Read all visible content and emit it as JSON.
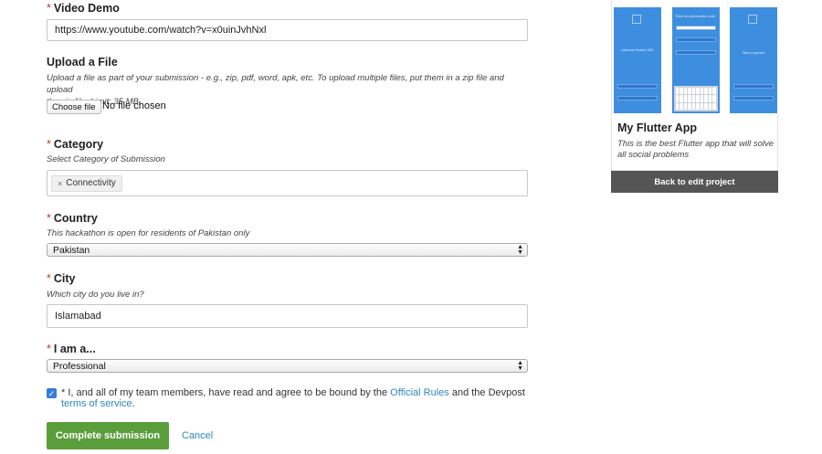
{
  "video_demo": {
    "label": "Video Demo",
    "required_mark": "*",
    "value": "https://www.youtube.com/watch?v=x0uinJvhNxl"
  },
  "upload": {
    "label": "Upload a File",
    "hint_line1": "Upload a file as part of your submission - e.g., zip, pdf, word, apk, etc. To upload multiple files, put them in a zip file and upload",
    "hint_line2": "the zip file. Limit: 35 MB.",
    "choose_label": "Choose file",
    "no_file": "No file chosen"
  },
  "category": {
    "label": "Category",
    "required_mark": "*",
    "hint": "Select Category of Submission",
    "tag_remove": "×",
    "tag": "Connectivity"
  },
  "country": {
    "label": "Country",
    "required_mark": "*",
    "hint": "This hackathon is open for residents of Pakistan only",
    "value": "Pakistan"
  },
  "city": {
    "label": "City",
    "required_mark": "*",
    "hint": "Which city do you live in?",
    "value": "Islamabad"
  },
  "iam": {
    "label": "I am a...",
    "required_mark": "*",
    "value": "Professional"
  },
  "agreement": {
    "checked": true,
    "prefix": "* I, and all of my team members, have read and agree to be bound by the ",
    "rules_link": "Official Rules",
    "middle": " and the Devpost",
    "tos_link": "terms of service",
    "suffix": "."
  },
  "actions": {
    "submit_label": "Complete submission",
    "cancel_label": "Cancel"
  },
  "project_card": {
    "title": "My Flutter App",
    "description": "This is the best Flutter app that will solve all social problems",
    "back_label": "Back to edit project",
    "screens": [
      {
        "caption": "Authorize Reader SDK",
        "icon": "app-icon"
      },
      {
        "caption": "Enter an authorization code",
        "icon": "keyboard-icon"
      },
      {
        "caption": "Take a payment",
        "icon": "app-icon"
      }
    ]
  },
  "colors": {
    "primary_button": "#5a9e3c",
    "link": "#2e86c1",
    "required": "#c0392b",
    "checkbox": "#2f7fd6",
    "dark_button": "#555555"
  }
}
